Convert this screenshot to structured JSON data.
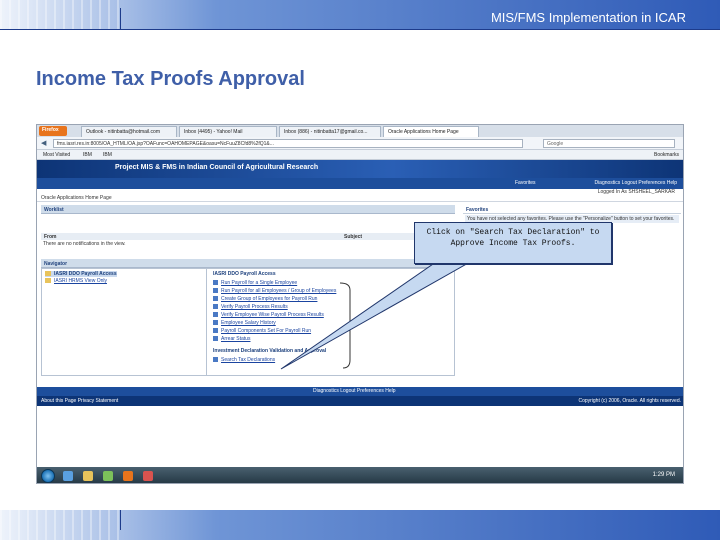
{
  "slide": {
    "header_title": "MIS/FMS Implementation in ICAR",
    "heading": "Income Tax Proofs Approval"
  },
  "browser": {
    "firefox_button": "Firefox",
    "tabs": [
      "Outlook - nitinbatta@hotmail.com",
      "Inbox (4495) - Yahoo! Mail",
      "Inbox (886) - nitinbatta17@gmail.co...",
      "Oracle Applications Home Page"
    ],
    "url": "fms.iasri.res.in:8005/OA_HTML/OA.jsp?OAFunc=OAHOMEPAGE&oasu=NcFuuZ8Cfd8%2fQ1&...",
    "search_placeholder": "Google",
    "bookmarks": [
      "Most Visited",
      "IBM",
      "IBM"
    ],
    "bookmarks_right": "Bookmarks"
  },
  "app": {
    "title": "Project MIS & FMS in Indian Council of Agricultural Research",
    "favorites_menu": "Favorites",
    "top_links": "Diagnostics   Logout   Preferences   Help",
    "logged_in": "Logged In As SHSHEEL_SARKAR",
    "breadcrumb": "Oracle Applications Home Page",
    "worklist": {
      "header": "Worklist",
      "col_from": "From",
      "col_subject": "Subject",
      "empty": "There are no notifications in the view."
    },
    "favorites": {
      "header": "Favorites",
      "message": "You have not selected any favorites. Please use the \"Personalize\" button to set your favorites."
    },
    "navigator": {
      "header": "Navigator",
      "left_items": [
        "IASRI DDO Payroll Access",
        "IASRI HRMS View Only"
      ],
      "right_header": "IASRI DDO Payroll Access",
      "right_items": [
        "Run Payroll for a Single Employee",
        "Run Payroll for all Employees / Group of Employees",
        "Create Group of Employees for Payroll Run",
        "Verify Payroll Process Results",
        "Verify Employee Wise Payroll Process Results",
        "Employee Salary History",
        "Payroll Components Set For Payroll Run",
        "Arrear Status"
      ],
      "investment_header": "Investment Declaration Validation and Approval",
      "investment_items": [
        "Search Tax Declarations"
      ]
    },
    "footer_links": "Diagnostics   Logout   Preferences   Help",
    "footer_left": "About this Page    Privacy Statement",
    "copyright": "Copyright (c) 2006, Oracle. All rights reserved.",
    "clock": "1:29 PM"
  },
  "callout": {
    "text": "Click on \"Search Tax Declaration\" to Approve Income Tax Proofs."
  },
  "colors": {
    "heading": "#3f5fa8",
    "callout_fill": "#c6d9f1",
    "app_header": "#0d3476"
  }
}
